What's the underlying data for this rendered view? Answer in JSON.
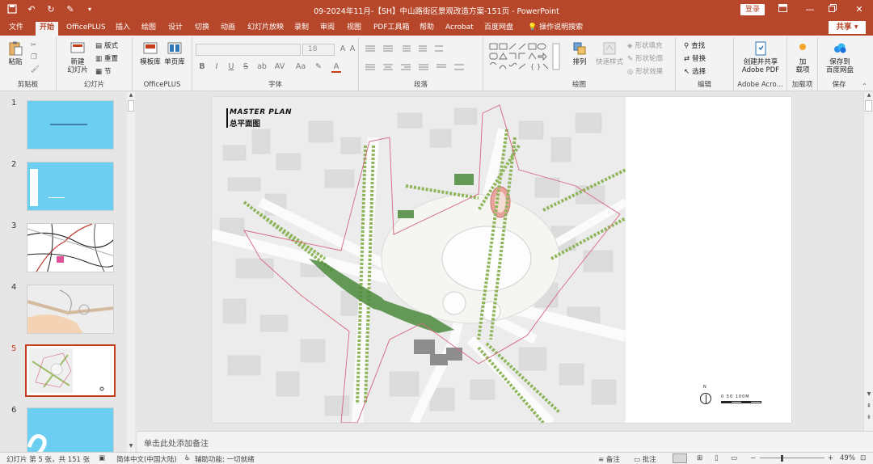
{
  "window": {
    "title": "09-2024年11月-【SH】中山路街区景观改造方案-151页  -  PowerPoint",
    "login_label": "登录",
    "share_label": "共享"
  },
  "tabs": [
    {
      "label": "文件"
    },
    {
      "label": "开始"
    },
    {
      "label": "OfficePLUS"
    },
    {
      "label": "插入"
    },
    {
      "label": "绘图"
    },
    {
      "label": "设计"
    },
    {
      "label": "切换"
    },
    {
      "label": "动画"
    },
    {
      "label": "幻灯片放映"
    },
    {
      "label": "录制"
    },
    {
      "label": "审阅"
    },
    {
      "label": "视图"
    },
    {
      "label": "PDF工具箱"
    },
    {
      "label": "帮助"
    },
    {
      "label": "Acrobat"
    },
    {
      "label": "百度网盘"
    },
    {
      "label": "操作说明搜索"
    }
  ],
  "ribbon": {
    "clipboard": {
      "title": "剪贴板",
      "paste": "粘贴"
    },
    "slides": {
      "title": "幻灯片",
      "new_slide_1": "新建",
      "new_slide_2": "幻灯片",
      "layout": "版式",
      "reset": "重置",
      "section": "节"
    },
    "officeplus": {
      "title": "OfficePLUS",
      "template": "模板库",
      "slide_lib": "单页库"
    },
    "font": {
      "title": "字体",
      "size": "18",
      "bold": "B",
      "italic": "I",
      "underline": "U",
      "strike": "S",
      "shadow": "ab",
      "spacing": "AV",
      "case": "Aa",
      "color": "A"
    },
    "paragraph": {
      "title": "段落"
    },
    "drawing": {
      "title": "绘图",
      "arrange": "排列",
      "quick_styles": "快速样式",
      "shape_fill": "形状填充",
      "shape_outline": "形状轮廓",
      "shape_effect": "形状效果"
    },
    "editing": {
      "title": "编辑",
      "find": "查找",
      "replace": "替换",
      "select": "选择"
    },
    "adobe": {
      "title": "Adobe Acro...",
      "btn_1": "创建并共享",
      "btn_2": "Adobe PDF"
    },
    "addins": {
      "title": "加载项",
      "btn_1": "加",
      "btn_2": "载项"
    },
    "save": {
      "title": "保存",
      "btn_1": "保存到",
      "btn_2": "百度网盘"
    }
  },
  "thumbnails": [
    {
      "num": "1"
    },
    {
      "num": "2"
    },
    {
      "num": "3"
    },
    {
      "num": "4"
    },
    {
      "num": "5"
    },
    {
      "num": "6"
    }
  ],
  "slide": {
    "heading_en": "MASTER PLAN",
    "heading_cn": "总平面图",
    "north_label": "N",
    "scale_label": "0    50    100M"
  },
  "notes_placeholder": "单击此处添加备注",
  "status": {
    "slide_info": "幻灯片 第 5 张，共 151 张",
    "language": "简体中文(中国大陆)",
    "accessibility": "辅助功能: 一切就绪",
    "notes_btn": "备注",
    "comments_btn": "批注",
    "zoom": "49%"
  },
  "colors": {
    "accent": "#b7472a",
    "selection": "#c43e1c",
    "thumb_blue": "#6ccff1",
    "boundary": "#d6667e",
    "green": "#8fb55a"
  }
}
